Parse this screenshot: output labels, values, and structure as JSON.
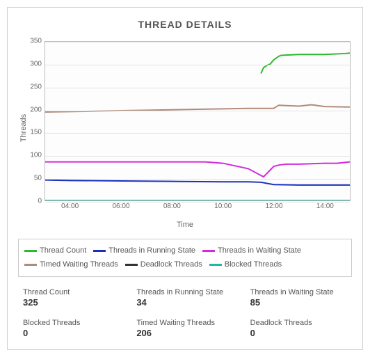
{
  "title": "THREAD DETAILS",
  "chart_data": {
    "type": "line",
    "xlabel": "Time",
    "ylabel": "Threads",
    "ylim": [
      0,
      350
    ],
    "xlim": [
      3,
      15
    ],
    "xticks": [
      "04:00",
      "06:00",
      "08:00",
      "10:00",
      "12:00",
      "14:00"
    ],
    "yticks": [
      0,
      50,
      100,
      150,
      200,
      250,
      300,
      350
    ],
    "series": [
      {
        "name": "Thread Count",
        "color": "#2eb82e",
        "x": [
          11.5,
          11.6,
          11.8,
          11.85,
          12.0,
          12.2,
          12.3,
          13.0,
          14.0,
          14.8,
          15.0
        ],
        "values": [
          280,
          293,
          300,
          300,
          310,
          318,
          320,
          322,
          322,
          324,
          325
        ]
      },
      {
        "name": "Threads in Running State",
        "color": "#1a2fbc",
        "x": [
          3.0,
          4.0,
          6.0,
          8.0,
          10.0,
          11.0,
          11.5,
          12.0,
          13.0,
          14.0,
          15.0
        ],
        "values": [
          45,
          44,
          43,
          42,
          41,
          41,
          40,
          35,
          34,
          34,
          34
        ]
      },
      {
        "name": "Threads in Waiting State",
        "color": "#d42adb",
        "x": [
          3.0,
          5.0,
          8.0,
          9.3,
          10.0,
          11.0,
          11.6,
          12.0,
          12.2,
          12.5,
          13.0,
          14.0,
          14.5,
          15.0
        ],
        "values": [
          85,
          85,
          85,
          85,
          82,
          70,
          52,
          75,
          78,
          80,
          80,
          82,
          82,
          85
        ]
      },
      {
        "name": "Timed Waiting Threads",
        "color": "#b08a7a",
        "x": [
          3.0,
          5.0,
          7.0,
          9.0,
          11.0,
          12.0,
          12.2,
          13.0,
          13.5,
          14.0,
          15.0
        ],
        "values": [
          195,
          197,
          199,
          201,
          203,
          203,
          210,
          208,
          211,
          207,
          206
        ]
      },
      {
        "name": "Deadlock Threads",
        "color": "#333333",
        "x": [
          3.0,
          15.0
        ],
        "values": [
          0,
          0
        ]
      },
      {
        "name": "Blocked Threads",
        "color": "#1fb5a8",
        "x": [
          3.0,
          15.0
        ],
        "values": [
          0,
          0
        ]
      }
    ]
  },
  "stats": [
    {
      "label": "Thread Count",
      "value": "325"
    },
    {
      "label": "Threads in Running State",
      "value": "34"
    },
    {
      "label": "Threads in Waiting State",
      "value": "85"
    },
    {
      "label": "Blocked Threads",
      "value": "0"
    },
    {
      "label": "Timed Waiting Threads",
      "value": "206"
    },
    {
      "label": "Deadlock Threads",
      "value": "0"
    }
  ]
}
